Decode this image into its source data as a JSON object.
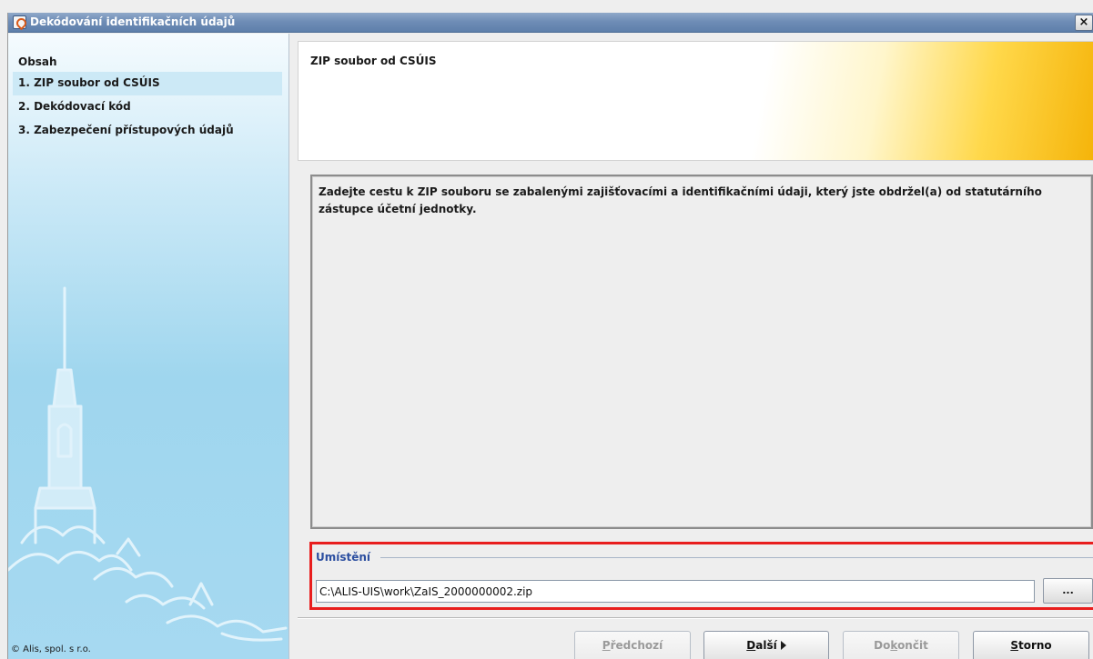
{
  "window": {
    "title": "Dekódování identifikačních údajů",
    "close_glyph": "×"
  },
  "sidebar": {
    "heading": "Obsah",
    "steps": [
      {
        "label": "1. ZIP soubor od CSÚIS",
        "active": true
      },
      {
        "label": "2. Dekódovací kód",
        "active": false
      },
      {
        "label": "3. Zabezpečení přístupových údajů",
        "active": false
      }
    ],
    "copyright": "© Alis, spol. s r.o."
  },
  "header": {
    "title": "ZIP soubor od CSÚIS"
  },
  "description": {
    "text": "Zadejte cestu k ZIP souboru se zabalenými zajišťovacími a identifikačními údaji, který jste obdržel(a) od statutárního zástupce účetní jednotky."
  },
  "location": {
    "label": "Umístění",
    "path_value": "C:\\ALIS-UIS\\work\\ZaIS_2000000002.zip",
    "browse_label": "..."
  },
  "buttons": {
    "previous": {
      "label_pre": "",
      "mnemonic": "P",
      "label_post": "ředchozí",
      "enabled": false
    },
    "next": {
      "label_pre": "",
      "mnemonic": "D",
      "label_post": "alší",
      "enabled": true
    },
    "finish": {
      "label_pre": "Do",
      "mnemonic": "k",
      "label_post": "ončit",
      "enabled": false
    },
    "cancel": {
      "label_pre": "",
      "mnemonic": "S",
      "label_post": "torno",
      "enabled": true
    }
  },
  "colors": {
    "title_bar": "#6f8db6",
    "highlight_border": "#e81e1e",
    "group_label": "#2c4fa0"
  },
  "icons": [
    "java-app-icon",
    "close-icon",
    "arrow-right-icon",
    "church-illustration"
  ]
}
